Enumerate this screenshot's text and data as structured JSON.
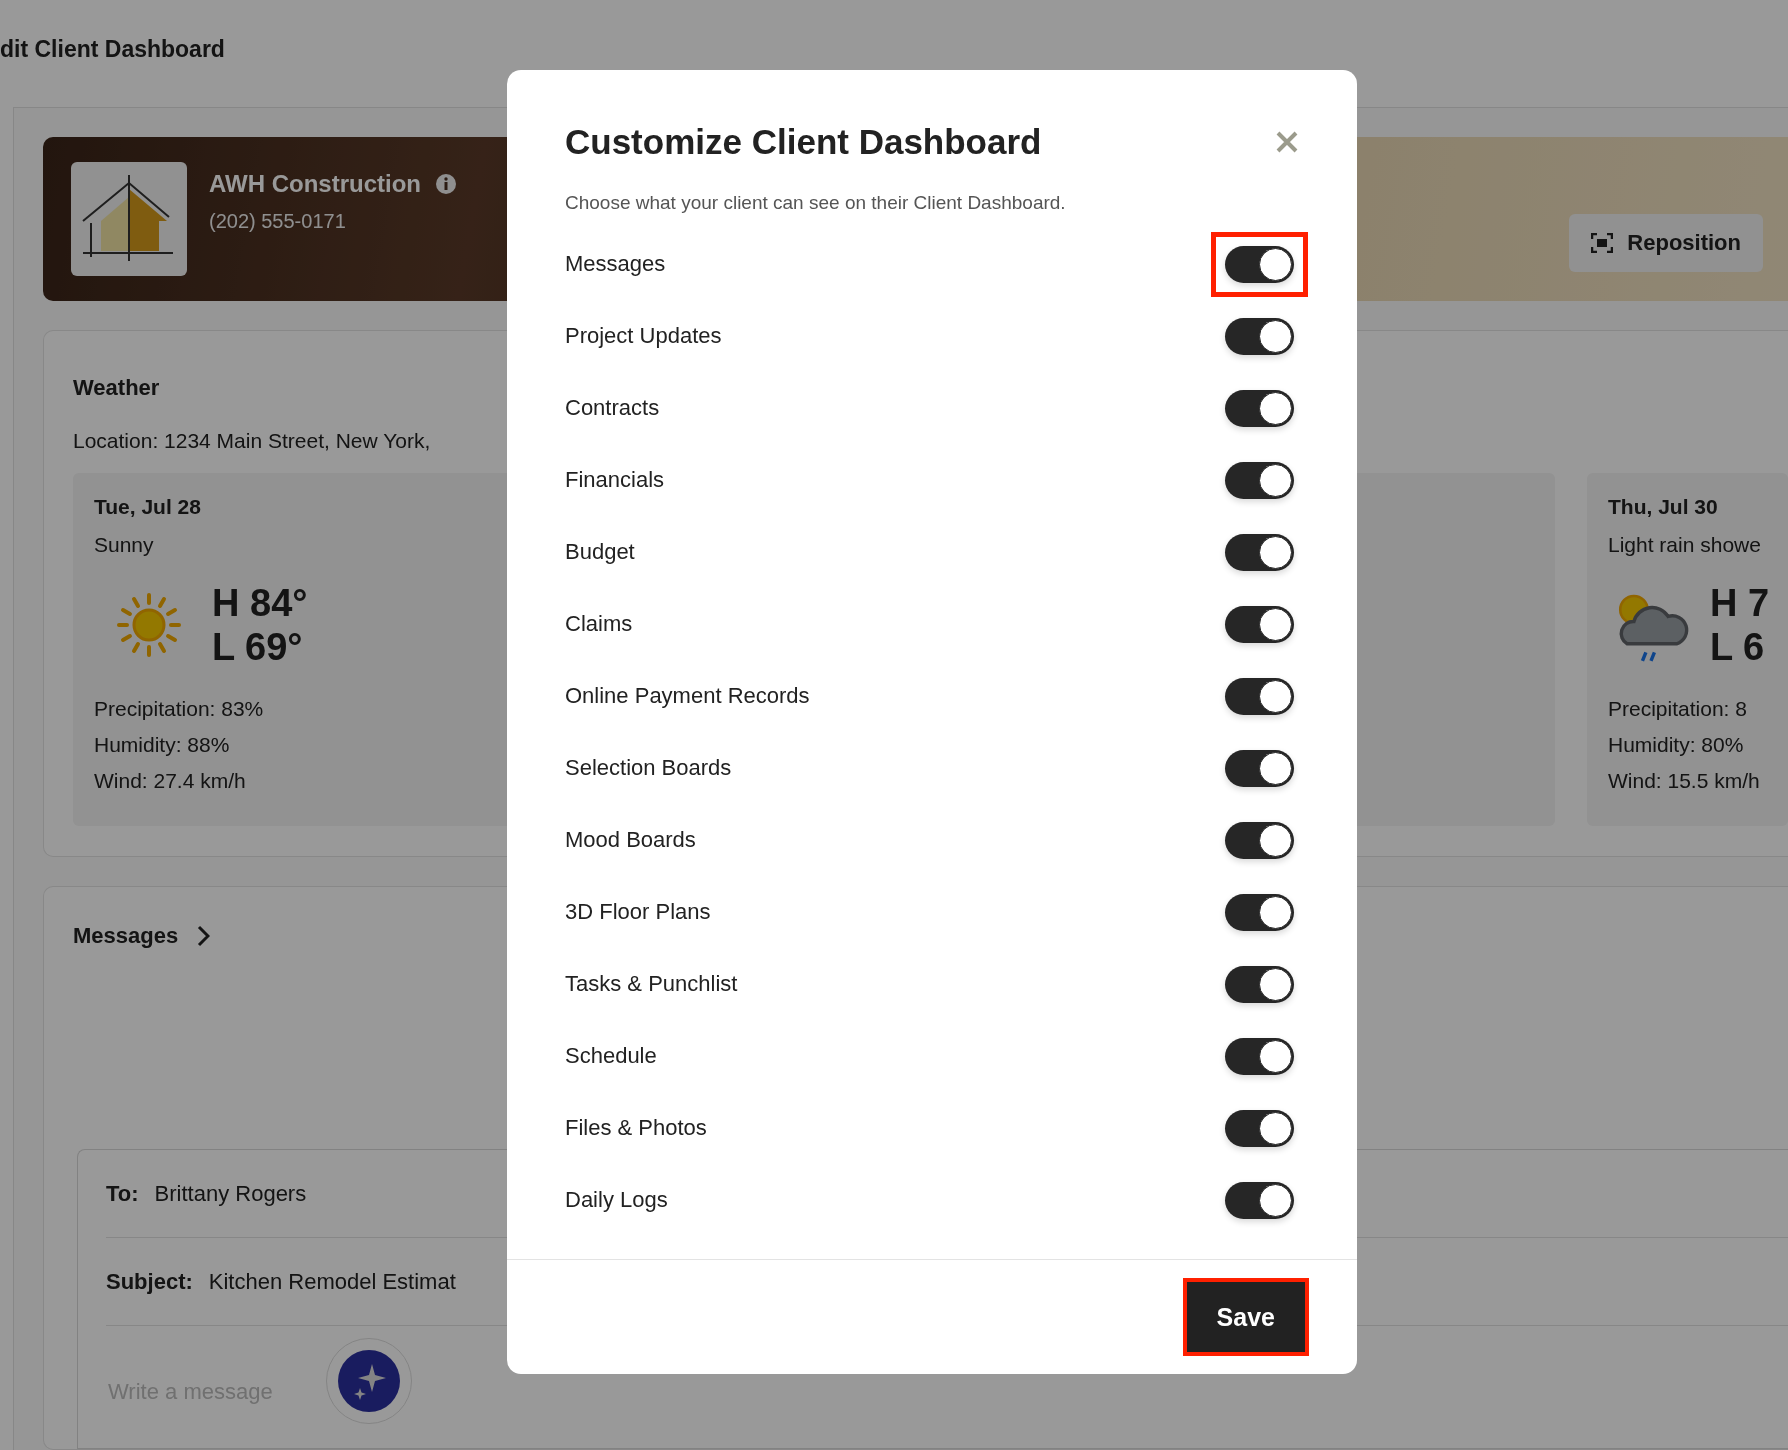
{
  "page": {
    "title": "dit Client Dashboard"
  },
  "banner": {
    "company": "AWH Construction",
    "phone": "(202) 555-0171",
    "reposition_button": "Reposition"
  },
  "weather": {
    "title": "Weather",
    "location": "Location: 1234 Main Street, New York,",
    "days": [
      {
        "kind": "sunny",
        "date": "Tue, Jul 28",
        "condition": "Sunny",
        "high": "H 84°",
        "low": "L 69°",
        "precipitation": "Precipitation: 83%",
        "humidity": "Humidity: 88%",
        "wind": "Wind: 27.4 km/h"
      },
      {
        "kind": "hidden"
      },
      {
        "kind": "rain",
        "date": "Thu, Jul 30",
        "condition": "Light rain showe",
        "high": "H 7",
        "low": "L 6",
        "precipitation": "Precipitation: 8",
        "humidity": "Humidity: 80%",
        "wind": "Wind: 15.5 km/h"
      }
    ]
  },
  "messages": {
    "title": "Messages",
    "to_label": "To:",
    "to": "Brittany Rogers",
    "subject_label": "Subject:",
    "subject": "Kitchen Remodel Estimat",
    "placeholder": "Write a message"
  },
  "modal": {
    "title": "Customize Client Dashboard",
    "subtitle": "Choose what your client can see on their Client Dashboard.",
    "toggles": [
      {
        "label": "Messages",
        "on": true,
        "highlighted": true
      },
      {
        "label": "Project Updates",
        "on": true,
        "highlighted": false
      },
      {
        "label": "Contracts",
        "on": true,
        "highlighted": false
      },
      {
        "label": "Financials",
        "on": true,
        "highlighted": false
      },
      {
        "label": "Budget",
        "on": true,
        "highlighted": false
      },
      {
        "label": "Claims",
        "on": true,
        "highlighted": false
      },
      {
        "label": "Online Payment Records",
        "on": true,
        "highlighted": false
      },
      {
        "label": "Selection Boards",
        "on": true,
        "highlighted": false
      },
      {
        "label": "Mood Boards",
        "on": true,
        "highlighted": false
      },
      {
        "label": "3D Floor Plans",
        "on": true,
        "highlighted": false
      },
      {
        "label": "Tasks & Punchlist",
        "on": true,
        "highlighted": false
      },
      {
        "label": "Schedule",
        "on": true,
        "highlighted": false
      },
      {
        "label": "Files & Photos",
        "on": true,
        "highlighted": false
      },
      {
        "label": "Daily Logs",
        "on": true,
        "highlighted": false
      }
    ],
    "save_button": {
      "label": "Save",
      "highlighted": true
    }
  }
}
